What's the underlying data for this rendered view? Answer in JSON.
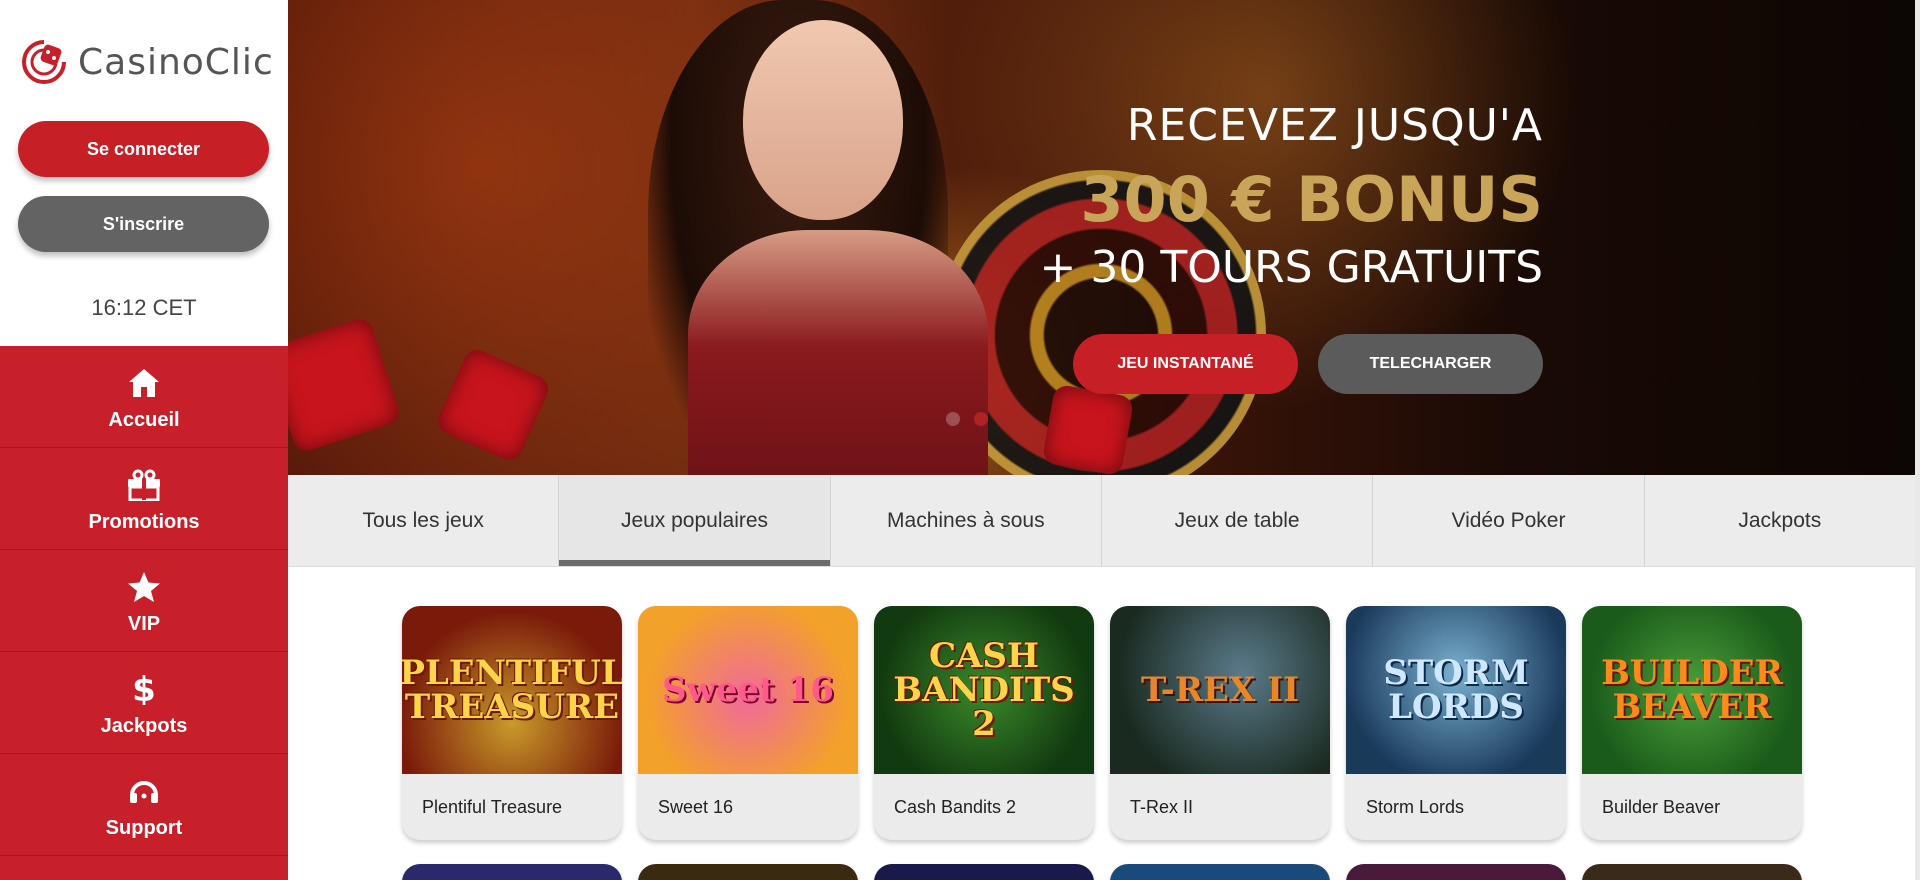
{
  "brand": {
    "name": "CasinoClic",
    "accent": "#c8202a"
  },
  "auth": {
    "login_label": "Se connecter",
    "signup_label": "S'inscrire"
  },
  "clock": "16:12 CET",
  "nav": [
    {
      "label": "Accueil",
      "icon": "home-icon"
    },
    {
      "label": "Promotions",
      "icon": "gift-icon"
    },
    {
      "label": "VIP",
      "icon": "star-icon"
    },
    {
      "label": "Jackpots",
      "icon": "dollar-icon"
    },
    {
      "label": "Support",
      "icon": "headset-icon"
    }
  ],
  "hero": {
    "line1": "RECEVEZ JUSQU'A",
    "line2": "300 € BONUS",
    "line3": "+ 30 TOURS GRATUITS",
    "instant_play_label": "JEU INSTANTANÉ",
    "download_label": "TELECHARGER",
    "slide_count": 2,
    "active_slide": 2
  },
  "tabs": [
    {
      "label": "Tous les jeux",
      "active": false
    },
    {
      "label": "Jeux populaires",
      "active": true
    },
    {
      "label": "Machines à sous",
      "active": false
    },
    {
      "label": "Jeux de table",
      "active": false
    },
    {
      "label": "Vidéo Poker",
      "active": false
    },
    {
      "label": "Jackpots",
      "active": false
    }
  ],
  "games": [
    {
      "name": "Plentiful Treasure",
      "art_text": "PLENTIFUL TREASURE"
    },
    {
      "name": "Sweet 16",
      "art_text": "Sweet 16"
    },
    {
      "name": "Cash Bandits 2",
      "art_text": "CASH BANDITS 2"
    },
    {
      "name": "T-Rex II",
      "art_text": "T-REX II"
    },
    {
      "name": "Storm Lords",
      "art_text": "STORM LORDS"
    },
    {
      "name": "Builder Beaver",
      "art_text": "BUILDER BEAVER"
    }
  ]
}
